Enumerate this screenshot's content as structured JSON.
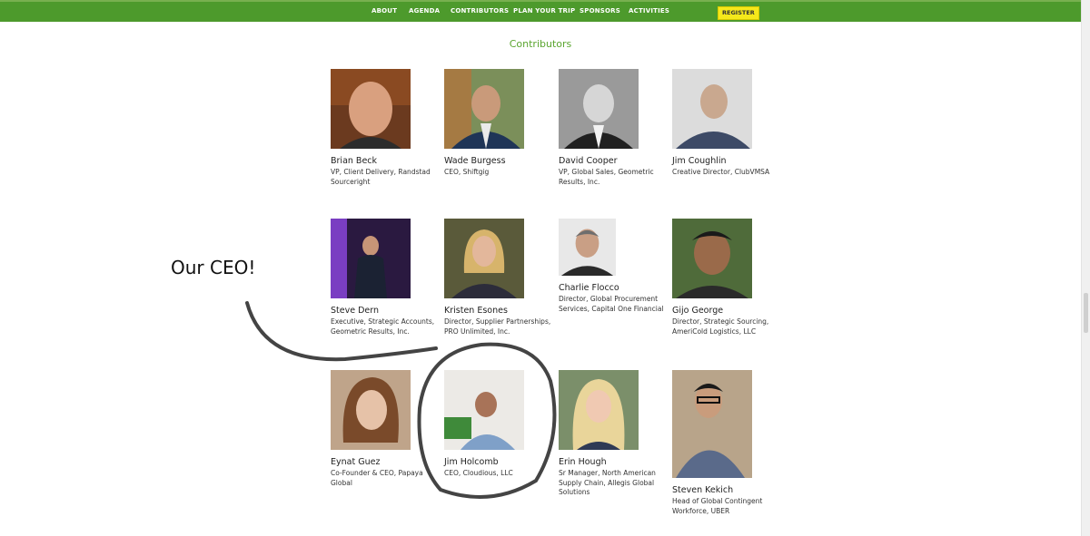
{
  "nav": {
    "items": [
      "ABOUT",
      "AGENDA",
      "CONTRIBUTORS",
      "PLAN YOUR TRIP",
      "SPONSORS",
      "ACTIVITIES"
    ],
    "register_label": "REGISTER"
  },
  "section": {
    "title": "Contributors"
  },
  "contributors": [
    {
      "name": "Brian Beck",
      "title": "VP, Client Delivery, Randstad Sourceright"
    },
    {
      "name": "Wade Burgess",
      "title": "CEO, Shiftgig"
    },
    {
      "name": "David Cooper",
      "title": "VP, Global Sales, Geometric Results, Inc."
    },
    {
      "name": "Jim Coughlin",
      "title": "Creative Director, ClubVMSA"
    },
    {
      "name": "Steve Dern",
      "title": "Executive, Strategic Accounts, Geometric Results, Inc."
    },
    {
      "name": "Kristen Esones",
      "title": "Director, Supplier Partnerships, PRO Unlimited, Inc."
    },
    {
      "name": "Charlie Flocco",
      "title": "Director, Global Procurement Services, Capital One Financial"
    },
    {
      "name": "Gijo George",
      "title": "Director, Strategic Sourcing, AmeriCold Logistics, LLC"
    },
    {
      "name": "Eynat Guez",
      "title": "Co-Founder & CEO, Papaya Global"
    },
    {
      "name": "Jim Holcomb",
      "title": "CEO, Cloudious, LLC"
    },
    {
      "name": "Erin Hough",
      "title": "Sr Manager, North American Supply Chain, Allegis Global Solutions"
    },
    {
      "name": "Steven Kekich",
      "title": "Head of Global Contingent Workforce, UBER"
    }
  ],
  "annotation": {
    "text": "Our CEO!"
  },
  "colors": {
    "nav_bg": "#4d9a2c",
    "title_green": "#5aa52f",
    "register_bg": "#f5e81b"
  }
}
